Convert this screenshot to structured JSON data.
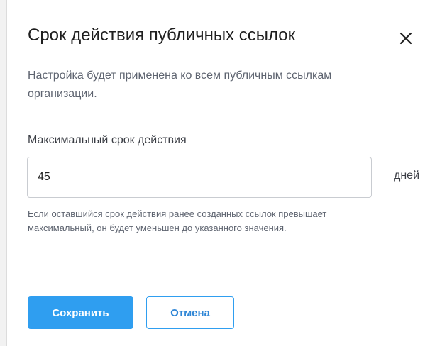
{
  "dialog": {
    "title": "Срок действия публичных ссылок",
    "close_icon": "close-icon",
    "description": "Настройка будет применена ко всем публичным ссылкам организации.",
    "field": {
      "label": "Максимальный срок действия",
      "value": "45",
      "unit": "дней",
      "hint": "Если оставшийся срок действия ранее созданных ссылок превышает максимальный, он будет уменьшен до указанного значения."
    },
    "buttons": {
      "save_label": "Сохранить",
      "cancel_label": "Отмена"
    }
  },
  "colors": {
    "accent": "#2f9ef0",
    "cancel_text": "#2f86d6",
    "text_primary": "#1f1f1f",
    "text_secondary": "#5e6470",
    "input_border": "#c9ccd1"
  }
}
